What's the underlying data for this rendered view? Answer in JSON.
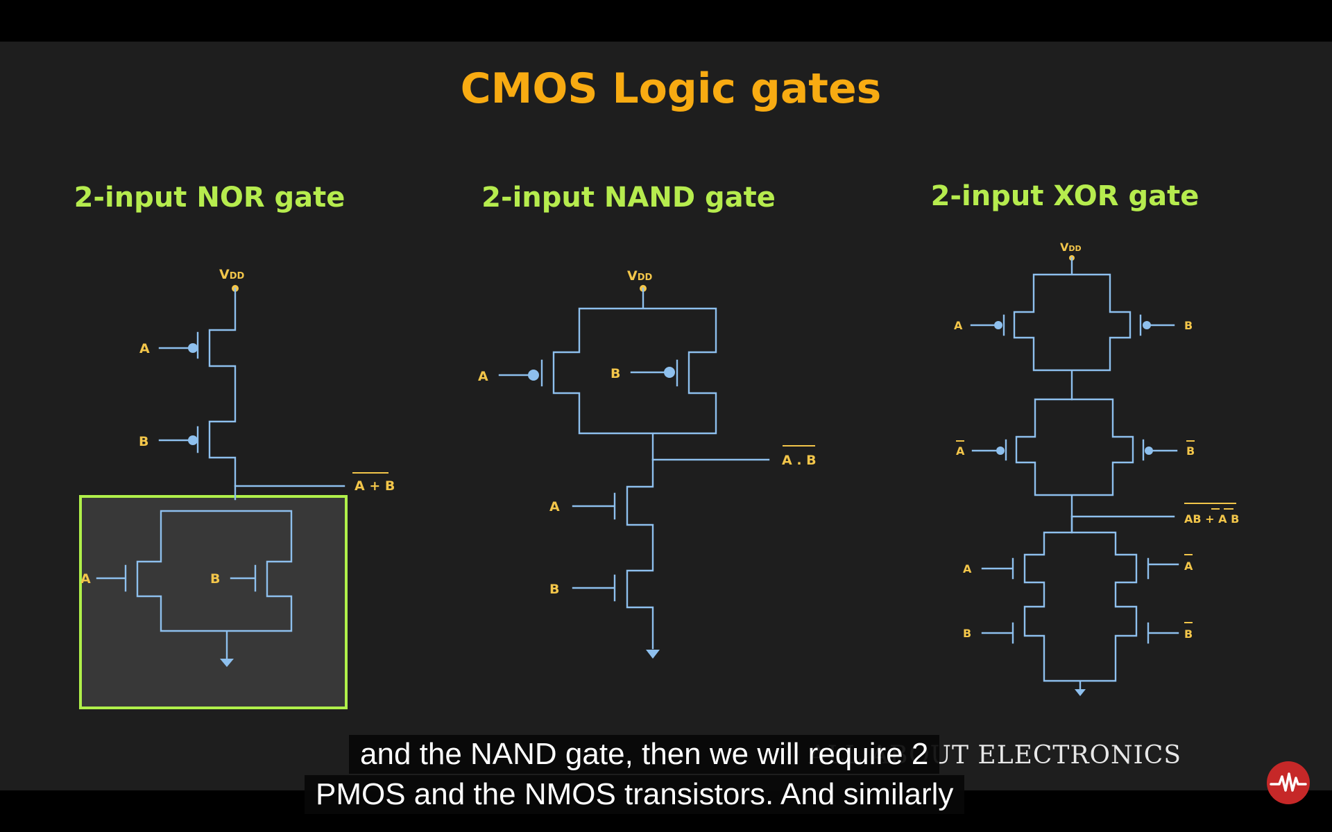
{
  "slide": {
    "title": "CMOS Logic gates"
  },
  "gates": {
    "nor": {
      "title": "2-input NOR gate",
      "supply": "V",
      "supply_sub": "DD",
      "input_a": "A",
      "input_b": "B",
      "output": "A + B",
      "pulldown_a": "A",
      "pulldown_b": "B"
    },
    "nand": {
      "title": "2-input NAND gate",
      "supply": "V",
      "supply_sub": "DD",
      "input_a": "A",
      "input_b": "B",
      "output": "A . B",
      "pulldown_a": "A",
      "pulldown_b": "B"
    },
    "xor": {
      "title": "2-input XOR gate",
      "supply": "V",
      "supply_sub": "DD",
      "pu1_left": "A",
      "pu1_right": "B",
      "pu2_left": "A",
      "pu2_right": "B",
      "output": "AB + A B",
      "pd1_left": "A",
      "pd1_right": "A",
      "pd2_left": "B",
      "pd2_right": "B"
    }
  },
  "watermark": "ALL ABOUT ELECTRONICS",
  "captions": [
    "and the NAND gate, then we will require 2",
    "PMOS and the NMOS transistors. And similarly"
  ],
  "colors": {
    "title": "#f8ab12",
    "gate_title": "#b6ec4e",
    "wire": "#8ec0ee",
    "label": "#f3c64a",
    "highlight": "#b0f04a",
    "logo": "#c62828"
  },
  "icons": {
    "logo": "waveform-logo-icon"
  }
}
